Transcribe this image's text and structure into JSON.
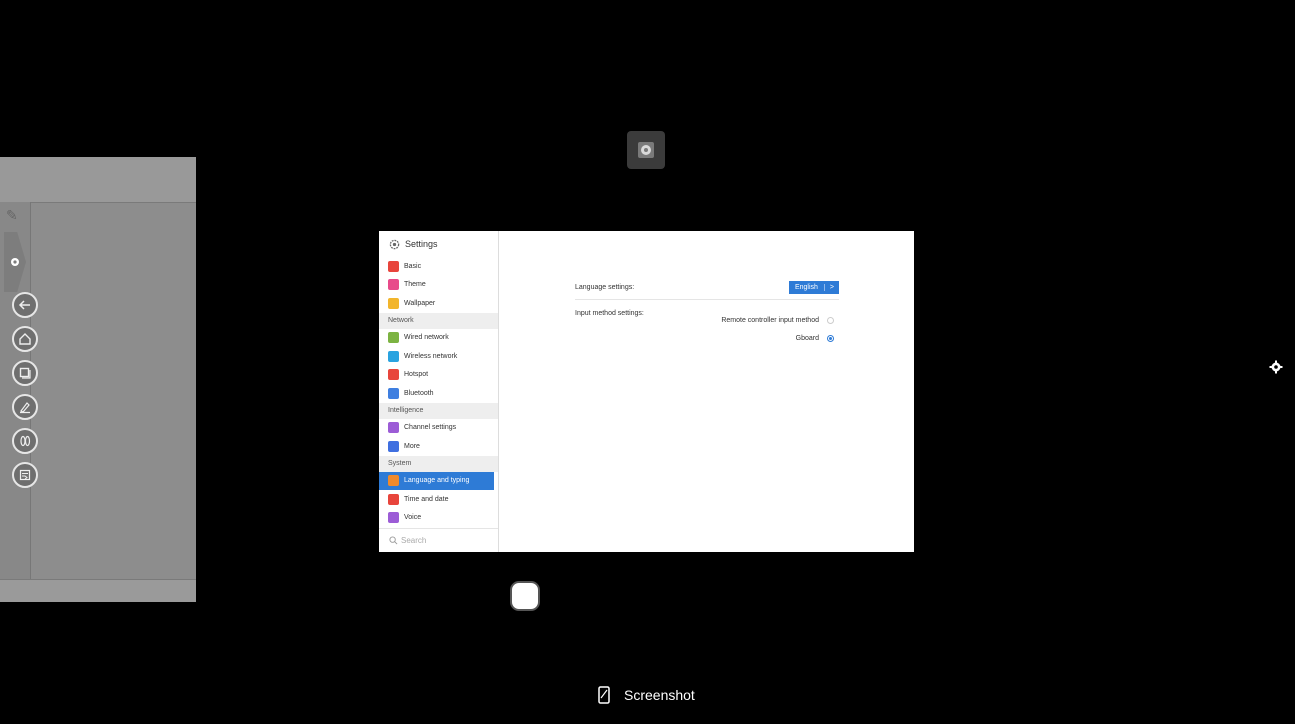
{
  "window_title": "Settings",
  "menu": {
    "groups": [
      {
        "header": "",
        "items": [
          {
            "label": "Basic",
            "color": "#e8453c"
          },
          {
            "label": "Theme",
            "color": "#e84a8a"
          },
          {
            "label": "Wallpaper",
            "color": "#f2b52c"
          }
        ]
      },
      {
        "header": "Network",
        "items": [
          {
            "label": "Wired network",
            "color": "#7cb342"
          },
          {
            "label": "Wireless network",
            "color": "#29a3e0"
          },
          {
            "label": "Hotspot",
            "color": "#e8453c"
          },
          {
            "label": "Bluetooth",
            "color": "#3f7fe0"
          }
        ]
      },
      {
        "header": "Intelligence",
        "items": [
          {
            "label": "Channel settings",
            "color": "#9c5cd6"
          },
          {
            "label": "More",
            "color": "#3f6fe0"
          }
        ]
      },
      {
        "header": "System",
        "items": [
          {
            "label": "Language and typing",
            "color": "#f08a2c",
            "active": true
          },
          {
            "label": "Time and date",
            "color": "#e8453c"
          },
          {
            "label": "Voice",
            "color": "#9c5cd6"
          }
        ]
      }
    ],
    "search_placeholder": "Search"
  },
  "content": {
    "language_label": "Language settings:",
    "language_value": "English",
    "language_chevron": ">",
    "input_label": "Input method settings:",
    "input_options": [
      {
        "label": "Remote controller input method",
        "selected": false
      },
      {
        "label": "Gboard",
        "selected": true
      }
    ]
  },
  "actions": {
    "screenshot_label": "Screenshot"
  },
  "colors": {
    "accent": "#2e7bd6"
  }
}
